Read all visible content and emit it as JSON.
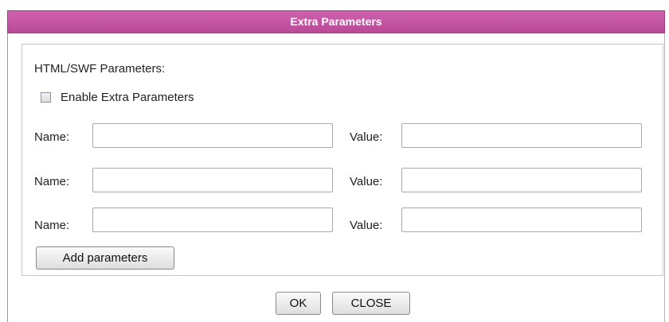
{
  "dialog": {
    "title": "Extra Parameters"
  },
  "section": {
    "title": "HTML/SWF Parameters:",
    "enable_label": "Enable Extra Parameters",
    "enable_checked": false
  },
  "params": [
    {
      "name_label": "Name:",
      "name_value": "",
      "value_label": "Value:",
      "value_value": ""
    },
    {
      "name_label": "Name:",
      "name_value": "",
      "value_label": "Value:",
      "value_value": ""
    },
    {
      "name_label": "Name:",
      "name_value": "",
      "value_label": "Value:",
      "value_value": ""
    }
  ],
  "buttons": {
    "add_label": "Add parameters",
    "ok_label": "OK",
    "close_label": "CLOSE"
  },
  "colors": {
    "title_bar": "#c456a3",
    "title_text": "#ffffff"
  }
}
